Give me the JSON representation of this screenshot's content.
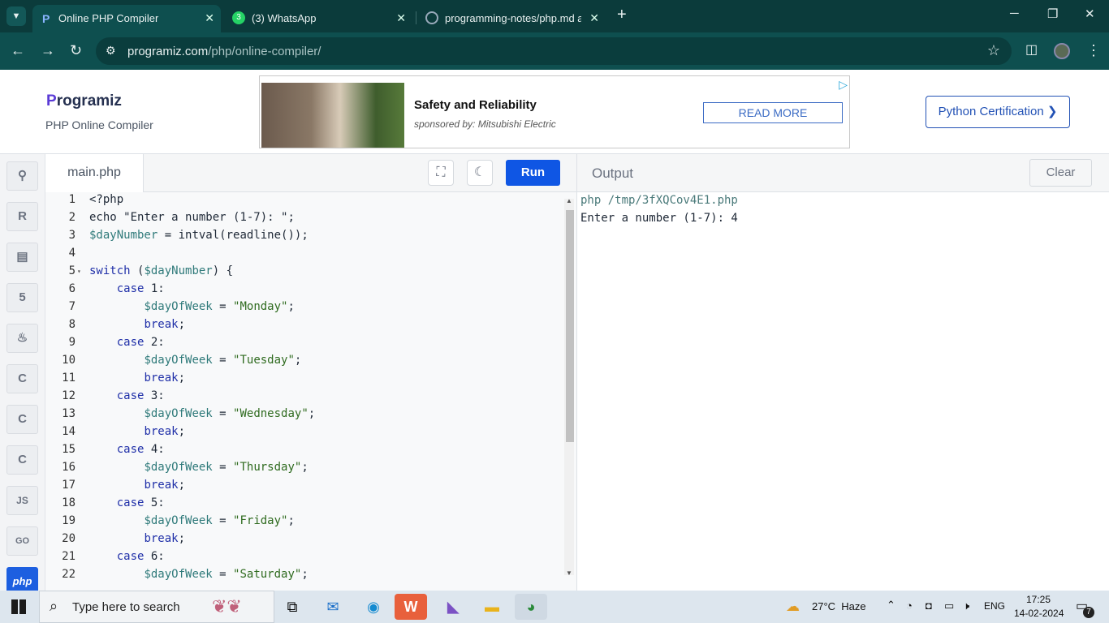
{
  "browser": {
    "tabs": [
      {
        "title": "Online PHP Compiler",
        "active": true,
        "icon": "programiz-favicon-icon"
      },
      {
        "title": "(3) WhatsApp",
        "active": false,
        "icon": "whatsapp-icon"
      },
      {
        "title": "programming-notes/php.md at",
        "active": false,
        "icon": "github-icon"
      }
    ],
    "url_host": "programiz.com",
    "url_path": "/php/online-compiler/"
  },
  "header": {
    "logo": "rogramiz",
    "logo_mark": "P",
    "subtitle": "PHP Online Compiler",
    "ad": {
      "title": "Safety and Reliability",
      "sponsor": "sponsored by: Mitsubishi Electric",
      "button": "READ MORE"
    },
    "cert_button": "Python Certification ❯"
  },
  "sidebar": {
    "languages": [
      {
        "name": "python",
        "glyph": "🐍"
      },
      {
        "name": "r",
        "glyph": "R"
      },
      {
        "name": "sql",
        "glyph": "▤"
      },
      {
        "name": "html",
        "glyph": "5"
      },
      {
        "name": "java",
        "glyph": "☕"
      },
      {
        "name": "c",
        "glyph": "C"
      },
      {
        "name": "cpp",
        "glyph": "C"
      },
      {
        "name": "csharp",
        "glyph": "C"
      },
      {
        "name": "js",
        "glyph": "JS"
      },
      {
        "name": "go",
        "glyph": "GO"
      },
      {
        "name": "php",
        "glyph": "php",
        "active": true
      }
    ]
  },
  "editor": {
    "file_tab": "main.php",
    "run_label": "Run",
    "lines": [
      {
        "n": "1",
        "code": "<?php"
      },
      {
        "n": "2",
        "code": "echo \"Enter a number (1-7): \";"
      },
      {
        "n": "3",
        "code": "$dayNumber = intval(readline());"
      },
      {
        "n": "4",
        "code": ""
      },
      {
        "n": "5",
        "code": "switch ($dayNumber) {"
      },
      {
        "n": "6",
        "code": "    case 1:"
      },
      {
        "n": "7",
        "code": "        $dayOfWeek = \"Monday\";"
      },
      {
        "n": "8",
        "code": "        break;"
      },
      {
        "n": "9",
        "code": "    case 2:"
      },
      {
        "n": "10",
        "code": "        $dayOfWeek = \"Tuesday\";"
      },
      {
        "n": "11",
        "code": "        break;"
      },
      {
        "n": "12",
        "code": "    case 3:"
      },
      {
        "n": "13",
        "code": "        $dayOfWeek = \"Wednesday\";"
      },
      {
        "n": "14",
        "code": "        break;"
      },
      {
        "n": "15",
        "code": "    case 4:"
      },
      {
        "n": "16",
        "code": "        $dayOfWeek = \"Thursday\";"
      },
      {
        "n": "17",
        "code": "        break;"
      },
      {
        "n": "18",
        "code": "    case 5:"
      },
      {
        "n": "19",
        "code": "        $dayOfWeek = \"Friday\";"
      },
      {
        "n": "20",
        "code": "        break;"
      },
      {
        "n": "21",
        "code": "    case 6:"
      },
      {
        "n": "22",
        "code": "        $dayOfWeek = \"Saturday\";"
      }
    ]
  },
  "output": {
    "title": "Output",
    "clear_label": "Clear",
    "lines": [
      {
        "text": "php /tmp/3fXQCov4E1.php",
        "color": "#4a7a7a"
      },
      {
        "text": "Enter a number (1-7): 4",
        "color": "#1f2937"
      }
    ]
  },
  "taskbar": {
    "search_placeholder": "Type here to search",
    "weather": "27°C  Haze",
    "language": "ENG",
    "time": "17:25",
    "date": "14-02-2024",
    "notification_count": "7"
  },
  "colors": {
    "accent": "#0f56e4",
    "browser_frame": "#0b3b3b"
  }
}
